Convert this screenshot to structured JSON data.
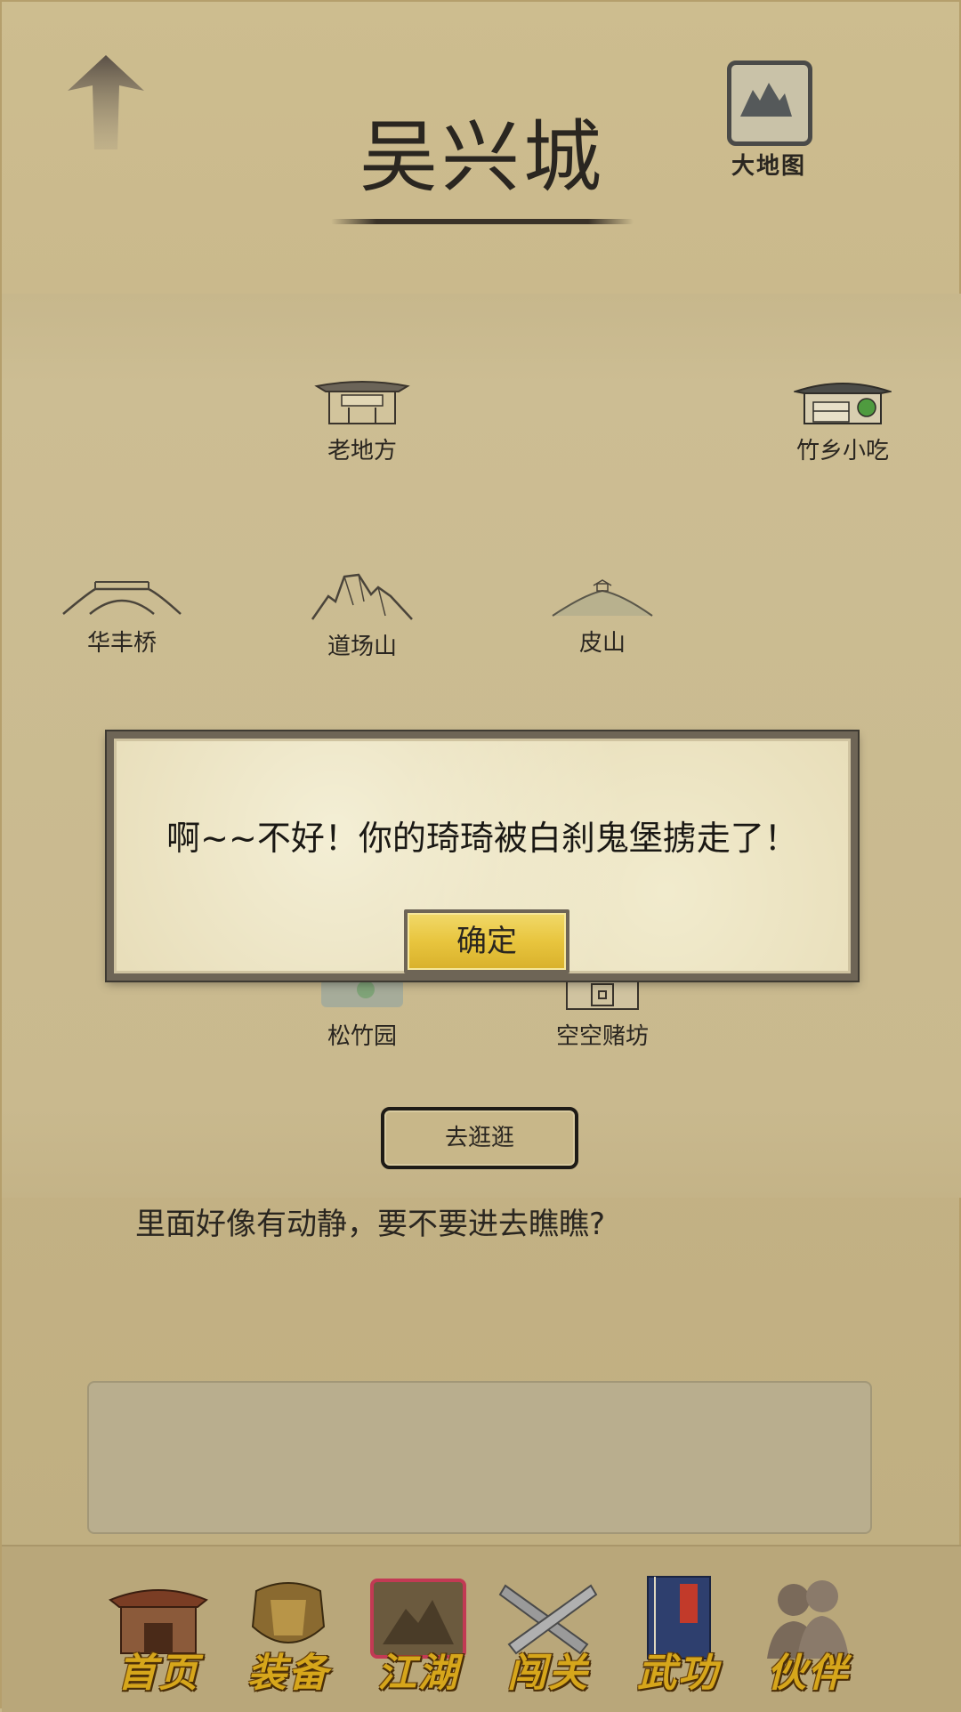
{
  "header": {
    "city_name": "吴兴城",
    "map_button_label": "大地图"
  },
  "locations": [
    {
      "id": "laodifang",
      "label": "老地方"
    },
    {
      "id": "zhuxiang",
      "label": "竹乡小吃"
    },
    {
      "id": "huafengqiao",
      "label": "华丰桥"
    },
    {
      "id": "daochangshan",
      "label": "道场山"
    },
    {
      "id": "pishan",
      "label": "皮山"
    },
    {
      "id": "songzhuyuan",
      "label": "松竹园"
    },
    {
      "id": "kongkongdufang",
      "label": "空空赌坊"
    }
  ],
  "actions": {
    "go_button_label": "去逛逛"
  },
  "description": "里面好像有动静，要不要进去瞧瞧?",
  "modal": {
    "message": "啊~~不好！你的琦琦被白刹鬼堡掳走了！",
    "confirm_label": "确定"
  },
  "bottom_nav": [
    {
      "label": "首页",
      "icon": "home-building-icon"
    },
    {
      "label": "装备",
      "icon": "armor-icon"
    },
    {
      "label": "江湖",
      "icon": "world-scroll-icon"
    },
    {
      "label": "闯关",
      "icon": "crossed-swords-icon"
    },
    {
      "label": "武功",
      "icon": "martial-book-icon"
    },
    {
      "label": "伙伴",
      "icon": "companions-icon"
    }
  ]
}
